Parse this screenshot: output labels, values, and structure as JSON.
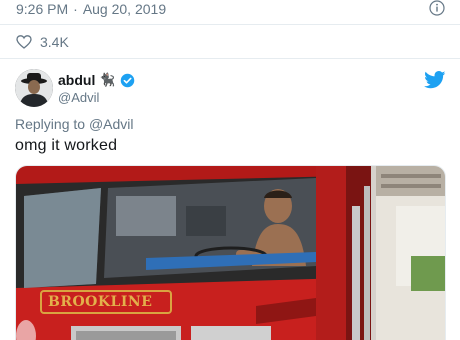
{
  "tweet": {
    "time": "9:26 PM",
    "separator": "·",
    "date": "Aug 20, 2019",
    "likes": "3.4K"
  },
  "reply": {
    "author_name": "abdul",
    "author_emoji": "🐈‍⬛",
    "handle": "@Advil",
    "replying_to_prefix": "Replying to",
    "replying_to_handle": "@Advil",
    "text": "omg it worked",
    "media_logo_text": "BROOKLINE"
  },
  "colors": {
    "twitter_blue": "#1da1f2",
    "muted_text": "#657786",
    "truck_red": "#c8201e"
  },
  "icons": [
    "info-icon",
    "heart-icon",
    "verified-badge-icon",
    "twitter-bird-icon"
  ]
}
